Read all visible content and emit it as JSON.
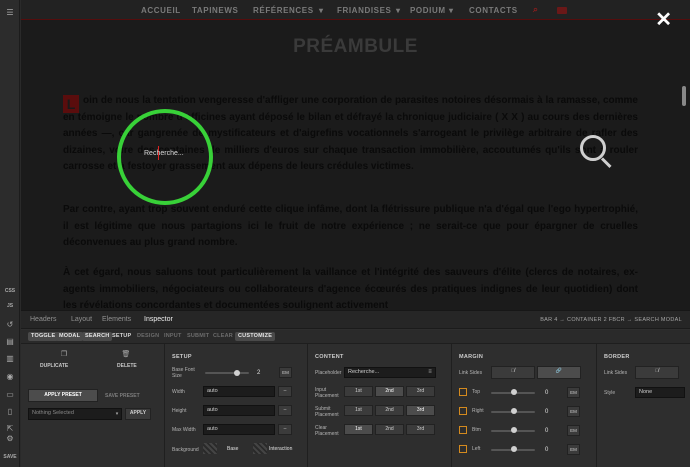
{
  "nav": {
    "items": [
      "ACCUEIL",
      "TAPINEWS",
      "RÉFÉRENCES",
      "FRIANDISES",
      "PODIUM",
      "CONTACTS"
    ],
    "references_suffix": "▾",
    "friandises_suffix": "▾",
    "podium_suffix": "▾",
    "close_glyph": "✕"
  },
  "page": {
    "title": "PRÉAMBULE",
    "dropcap": "L",
    "para1": "oin de nous la tentation vengeresse d'affliger une corporation de parasites notoires désormais à la ramasse, comme en témoigne le nombre d'officines ayant déposé le bilan et défrayé la chronique judiciaire ( X X ) au cours des dernières années —, car gangrenée de mystificateurs et d'aigrefins vocationnels s'arrogeant le privilège arbitraire de rafler des dizaines, voire des centaines de milliers d'euros sur chaque transaction immobilière, accoutumés qu'ils sont à rouler carrosse et à festoyer grassement aux dépens de leurs crédules victimes.",
    "para2": "Par contre, ayant trop souvent enduré cette clique infâme, dont la flétrissure publique n'a d'égal que l'ego hypertrophié, il est légitime que nous partagions ici le fruit de notre expérience ; ne serait-ce que pour épargner de cruelles déconvenues au plus grand nombre.",
    "para3": "À cet égard, nous saluons tout particulièrement la vaillance et l'intégrité des sauveurs d'élite (clercs de notaires, ex-agents immobiliers, négociateurs ou collaborateurs d'agence écœurés des pratiques indignes de leur quotidien) dont les révélations concordantes et documentées soulignent activement",
    "search_placeholder": "Recherche..."
  },
  "rail": {
    "labels": [
      "CSS",
      "JS",
      "SAVE"
    ]
  },
  "panel": {
    "tabs": [
      "Headers",
      "Layout",
      "Elements",
      "Inspector"
    ],
    "breadcrumb": "BAR 4  →  CONTAINER 2 FBCR  →  SEARCH MODAL",
    "subtabs": [
      "TOGGLE",
      "MODAL",
      "SEARCH",
      "SETUP",
      "DESIGN",
      "INPUT",
      "SUBMIT",
      "CLEAR",
      "CUSTOMIZE"
    ],
    "left": {
      "duplicate": "DUPLICATE",
      "delete": "DELETE",
      "apply_preset": "APPLY PRESET",
      "save_preset": "SAVE PRESET",
      "nothing_selected": "Nothing Selected",
      "apply": "APPLY"
    },
    "setup": {
      "heading": "SETUP",
      "base_font_size_label": "Base Font Size",
      "base_font_size_value": "2",
      "base_font_unit": "EM",
      "width_label": "Width",
      "width_value": "auto",
      "height_label": "Height",
      "height_value": "auto",
      "max_width_label": "Max Width",
      "max_width_value": "auto",
      "background_label": "Background",
      "bg_base": "Base",
      "bg_interaction": "Interaction"
    },
    "content": {
      "heading": "CONTENT",
      "placeholder_label": "Placeholder",
      "placeholder_value": "Recherche...",
      "input_placement_label": "Input Placement",
      "submit_placement_label": "Submit Placement",
      "clear_placement_label": "Clear Placement",
      "opts": [
        "1st",
        "2nd",
        "3rd"
      ]
    },
    "margin": {
      "heading": "MARGIN",
      "link_sides": "Link Sides",
      "top": "Top",
      "right": "Right",
      "btm": "Btm",
      "left": "Left",
      "value": "0",
      "unit": "EM"
    },
    "border": {
      "heading": "BORDER",
      "link_sides": "Link Sides",
      "style_label": "Style",
      "style_value": "None"
    }
  }
}
